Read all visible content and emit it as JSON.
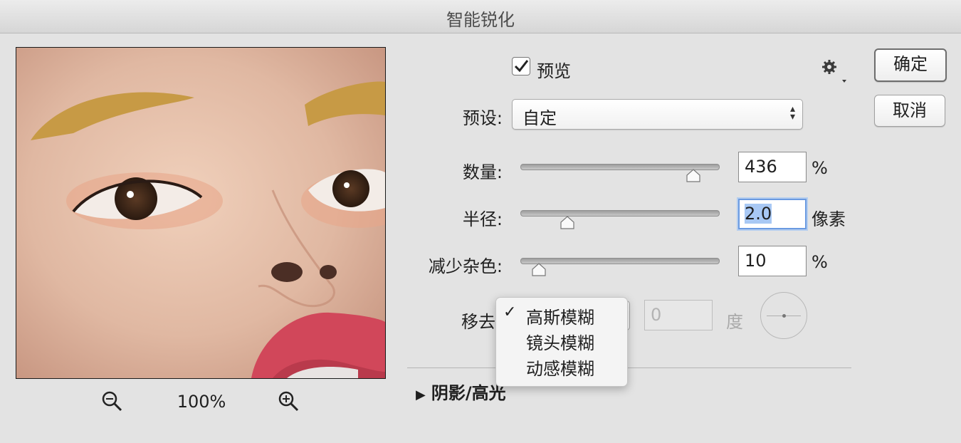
{
  "window": {
    "title": "智能锐化"
  },
  "preview": {
    "enabled": true,
    "label": "预览",
    "zoom": "100%",
    "image_alt": "face close-up preview"
  },
  "settings_icon": "gear-icon",
  "preset": {
    "label": "预设:",
    "value": "自定"
  },
  "sliders": {
    "amount": {
      "label": "数量:",
      "value": "436",
      "unit": "%",
      "level": 0.88
    },
    "radius": {
      "label": "半径:",
      "value": "2.0",
      "unit": "像素",
      "level": 0.22
    },
    "noise": {
      "label": "减少杂色:",
      "value": "10",
      "unit": "%",
      "level": 0.08
    }
  },
  "remove": {
    "label": "移去",
    "angle_value": "0",
    "angle_unit": "度",
    "menu": {
      "items": [
        {
          "label": "高斯模糊",
          "checked": true
        },
        {
          "label": "镜头模糊",
          "checked": false
        },
        {
          "label": "动感模糊",
          "checked": false
        }
      ],
      "check_mark": "✓"
    }
  },
  "section": {
    "label": "阴影/高光",
    "icon": "triangle-right-icon"
  },
  "buttons": {
    "ok": "确定",
    "cancel": "取消"
  },
  "colors": {
    "focus": "#6a9ae1",
    "selection": "#a8c8f4"
  }
}
